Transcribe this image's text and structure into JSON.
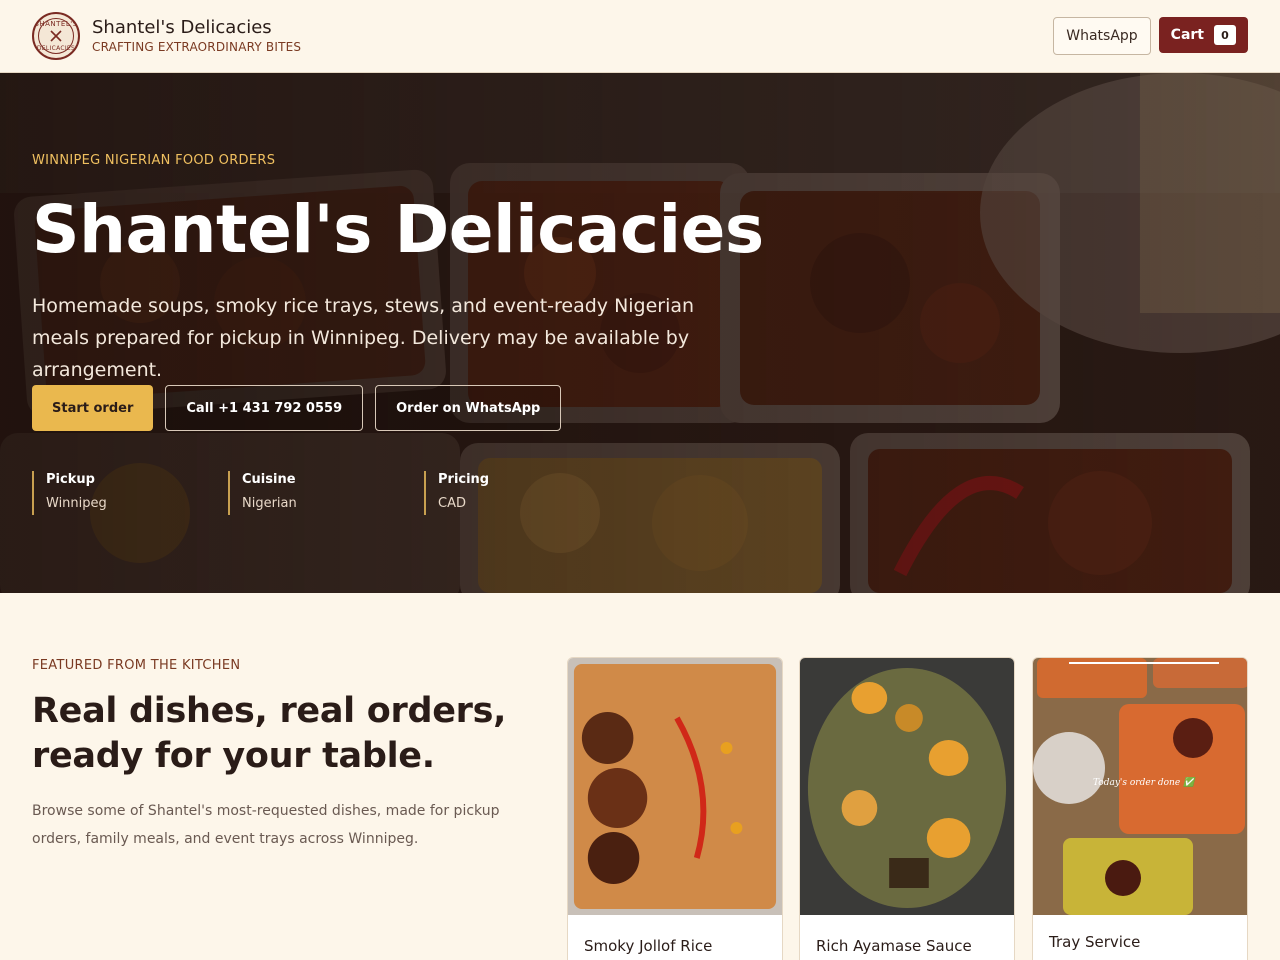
{
  "brand": {
    "name": "Shantel's Delicacies",
    "tagline": "CRAFTING EXTRAORDINARY BITES",
    "logo_top": "SHANTEL'S",
    "logo_bottom": "DELICACIES"
  },
  "header": {
    "whatsapp_label": "WhatsApp",
    "cart_label": "Cart",
    "cart_count": "0"
  },
  "hero": {
    "eyebrow": "WINNIPEG NIGERIAN FOOD ORDERS",
    "title": "Shantel's Delicacies",
    "description": "Homemade soups, smoky rice trays, stews, and event-ready Nigerian meals prepared for pickup in Winnipeg. Delivery may be available by arrangement.",
    "buttons": {
      "start": "Start order",
      "call": "Call +1 431 792 0559",
      "whatsapp": "Order on WhatsApp"
    },
    "stats": [
      {
        "label": "Pickup",
        "value": "Winnipeg"
      },
      {
        "label": "Cuisine",
        "value": "Nigerian"
      },
      {
        "label": "Pricing",
        "value": "CAD"
      }
    ]
  },
  "featured": {
    "eyebrow": "FEATURED FROM THE KITCHEN",
    "title": "Real dishes, real orders, ready for your table.",
    "description": "Browse some of Shantel's most-requested dishes, made for pickup orders, family meals, and event trays across Winnipeg.",
    "cards": [
      {
        "title": "Smoky Jollof Rice"
      },
      {
        "title": "Rich Ayamase Sauce"
      },
      {
        "title": "Tray Service",
        "image_caption": "Today's order done ✅"
      }
    ]
  },
  "colors": {
    "accent": "#7a2220",
    "gold": "#eab84e",
    "cream": "#fdf6ea"
  }
}
